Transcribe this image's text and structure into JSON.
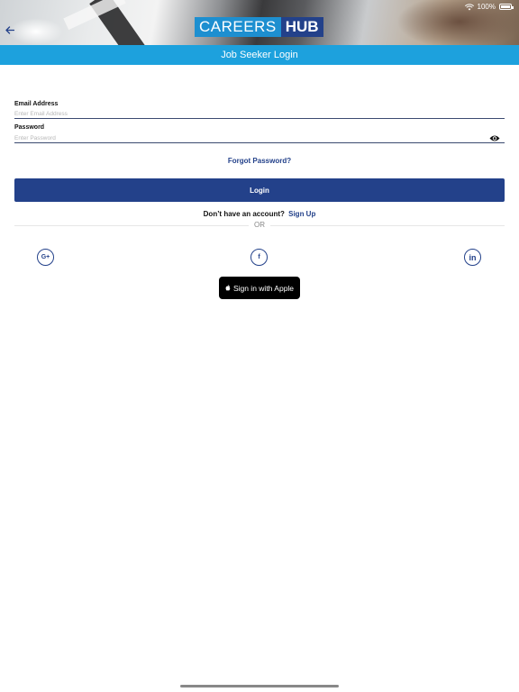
{
  "status_bar": {
    "battery": "100%"
  },
  "header": {
    "logo_left": "CAREERS",
    "logo_right": "HUB",
    "title": "Job Seeker Login"
  },
  "form": {
    "email_label": "Email Address",
    "email_placeholder": "Enter Email Address",
    "password_label": "Password",
    "password_placeholder": "Enter Password"
  },
  "links": {
    "forgot_password": "Forgot Password?",
    "signup_prompt": "Don’t have an account?",
    "signup": "Sign Up",
    "or": "OR"
  },
  "buttons": {
    "login": "Login",
    "apple": "Sign in with Apple"
  },
  "social": {
    "google": "G+",
    "facebook": "f",
    "linkedin": "in"
  },
  "colors": {
    "brand_dark": "#23418a",
    "brand_light": "#1da1dd"
  }
}
